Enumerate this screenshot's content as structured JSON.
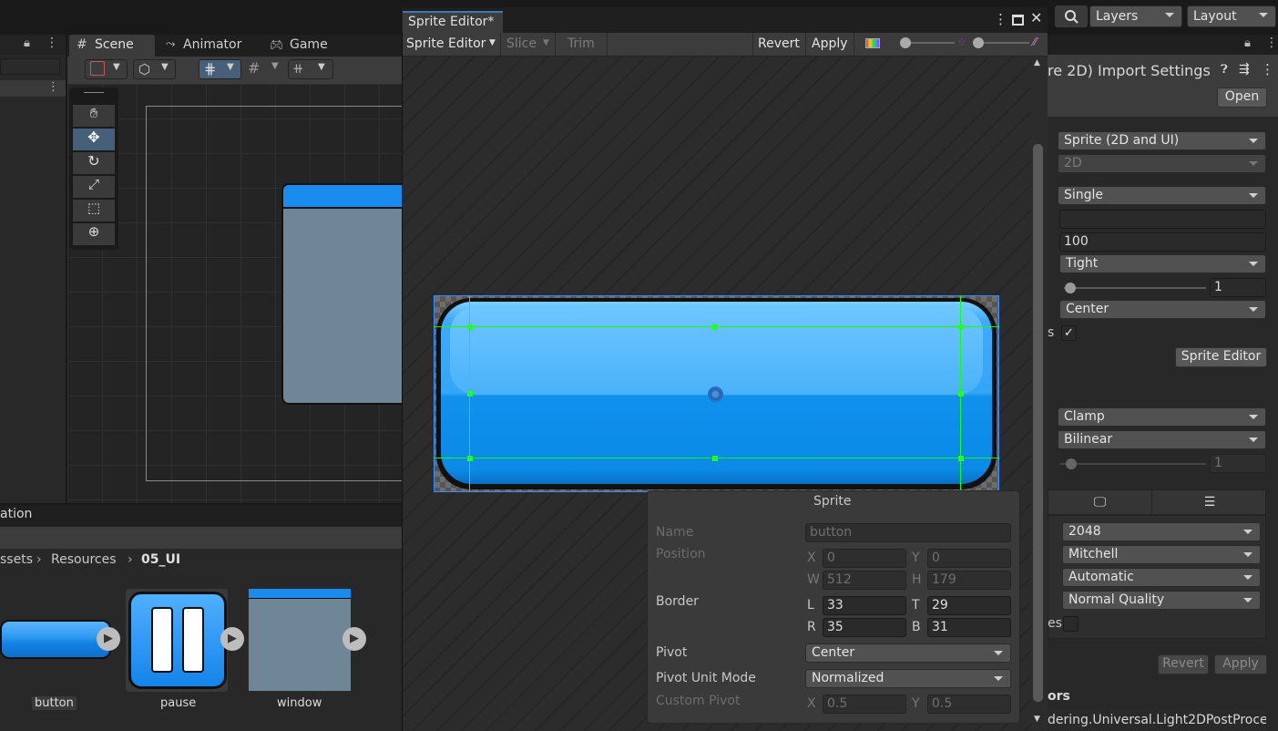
{
  "top_bar": {
    "layers": "Layers",
    "layout": "Layout"
  },
  "scene_tabs": [
    {
      "label": "Scene"
    },
    {
      "label": "Animator"
    },
    {
      "label": "Game"
    }
  ],
  "project": {
    "panel_title": "ation",
    "breadcrumb": [
      "ssets",
      "Resources",
      "05_UI"
    ],
    "assets": [
      {
        "name": "button"
      },
      {
        "name": "pause"
      },
      {
        "name": "window"
      }
    ]
  },
  "sprite_editor": {
    "window_title": "Sprite Editor*",
    "toolbar": {
      "mode": "Sprite Editor",
      "slice": "Slice",
      "trim": "Trim",
      "revert": "Revert",
      "apply": "Apply"
    },
    "panel": {
      "title": "Sprite",
      "name_label": "Name",
      "name_value": "button",
      "position_label": "Position",
      "x_label": "X",
      "x_value": "0",
      "y_label": "Y",
      "y_value": "0",
      "w_label": "W",
      "w_value": "512",
      "h_label": "H",
      "h_value": "179",
      "border_label": "Border",
      "l_label": "L",
      "l_value": "33",
      "t_label": "T",
      "t_value": "29",
      "r_label": "R",
      "r_value": "35",
      "b_label": "B",
      "b_value": "31",
      "pivot_label": "Pivot",
      "pivot_value": "Center",
      "unit_mode_label": "Pivot Unit Mode",
      "unit_mode_value": "Normalized",
      "custom_pivot_label": "Custom Pivot",
      "cp_x_label": "X",
      "cp_x_value": "0.5",
      "cp_y_label": "Y",
      "cp_y_value": "0.5"
    }
  },
  "inspector": {
    "title": "re 2D) Import Settings",
    "open": "Open",
    "texture_type": "Sprite (2D and UI)",
    "texture_shape": "2D",
    "sprite_mode": "Single",
    "packing_tag": "",
    "pixels_per_unit": "100",
    "mesh_type": "Tight",
    "extrude_edges": "1",
    "pivot": "Center",
    "partial_label": "s",
    "sprite_editor_button": "Sprite Editor",
    "wrap_mode": "Clamp",
    "filter_mode": "Bilinear",
    "aniso_level": "1",
    "max_size": "2048",
    "resize_algorithm": "Mitchell",
    "format": "Automatic",
    "compression": "Normal Quality",
    "partial_label2": "es",
    "revert": "Revert",
    "apply": "Apply",
    "footer_header": "ors",
    "footer_text": "dering.Universal.Light2DPostProce"
  }
}
